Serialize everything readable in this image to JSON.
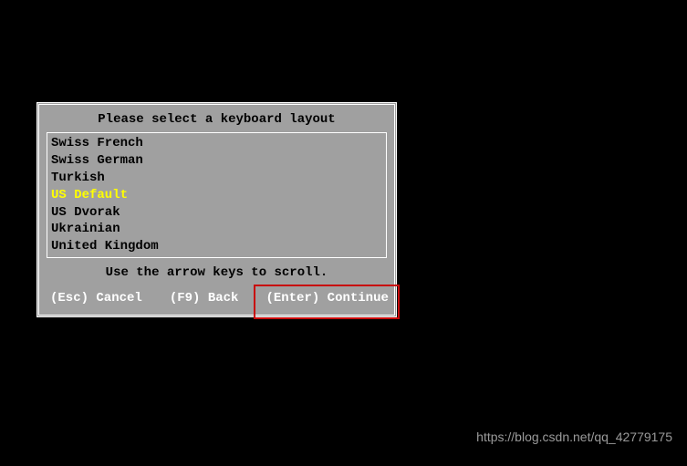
{
  "dialog": {
    "title": "Please select a keyboard layout",
    "items": [
      {
        "label": "Swiss French",
        "selected": false
      },
      {
        "label": "Swiss German",
        "selected": false
      },
      {
        "label": "Turkish",
        "selected": false
      },
      {
        "label": "US Default",
        "selected": true
      },
      {
        "label": "US Dvorak",
        "selected": false
      },
      {
        "label": "Ukrainian",
        "selected": false
      },
      {
        "label": "United Kingdom",
        "selected": false
      }
    ],
    "hint": "Use the arrow keys to scroll.",
    "actions": {
      "cancel": "(Esc) Cancel",
      "back": "(F9) Back",
      "continue": "(Enter) Continue"
    }
  },
  "annotation": {
    "highlight_color": "#c80a0a"
  },
  "watermark": "https://blog.csdn.net/qq_42779175"
}
